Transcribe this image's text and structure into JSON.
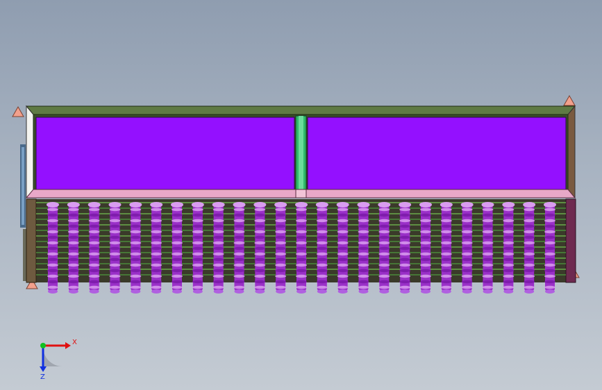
{
  "viewport": {
    "background_top": "#8f9db0",
    "background_bottom": "#c4cbd3"
  },
  "model": {
    "frame_color": "#5f7a44",
    "panel_color": "#9410ff",
    "divider_color": "#2fb86a",
    "rail_color": "#e8a8c8",
    "side_color": "#6e5a40",
    "fin_color": "#9a30c8",
    "fin_highlight": "#d99cf0",
    "fin_count": 25,
    "corner_color": "#f2a08c"
  },
  "triad": {
    "x_label": "X",
    "z_label": "Z",
    "x_color": "#e01010",
    "y_color": "#10c020",
    "z_color": "#1030e0"
  }
}
